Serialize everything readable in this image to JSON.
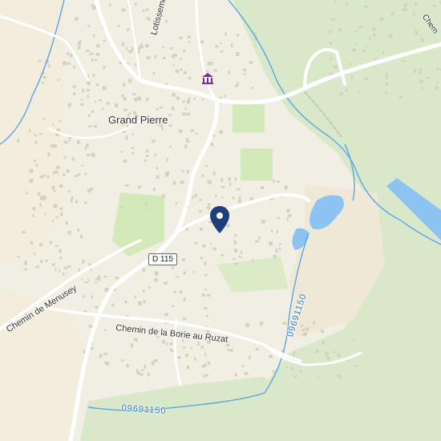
{
  "colors": {
    "background": "#f1efe3",
    "forest": "#d9e8c8",
    "park": "#d3e9b9",
    "field": "#ede6d5",
    "water": "#8cc3f2",
    "river": "#5aa4e8",
    "road": "#ffffff",
    "building": "#d9d3c2",
    "pin": "#1f3f7a",
    "museum": "#7b2c9d"
  },
  "labels": {
    "town": "Grand Pierre",
    "lotissement": "Lotissement de Piro",
    "road_shield": "D 115",
    "road_menusey": "Chemin de Menusey",
    "road_borie": "Chemin de la Borie au Ruzat",
    "stream_a": "09691150",
    "stream_b": "09691150",
    "edge_label": "Chem"
  },
  "icons": {
    "museum": "museum-icon",
    "pin": "location-pin-icon"
  }
}
